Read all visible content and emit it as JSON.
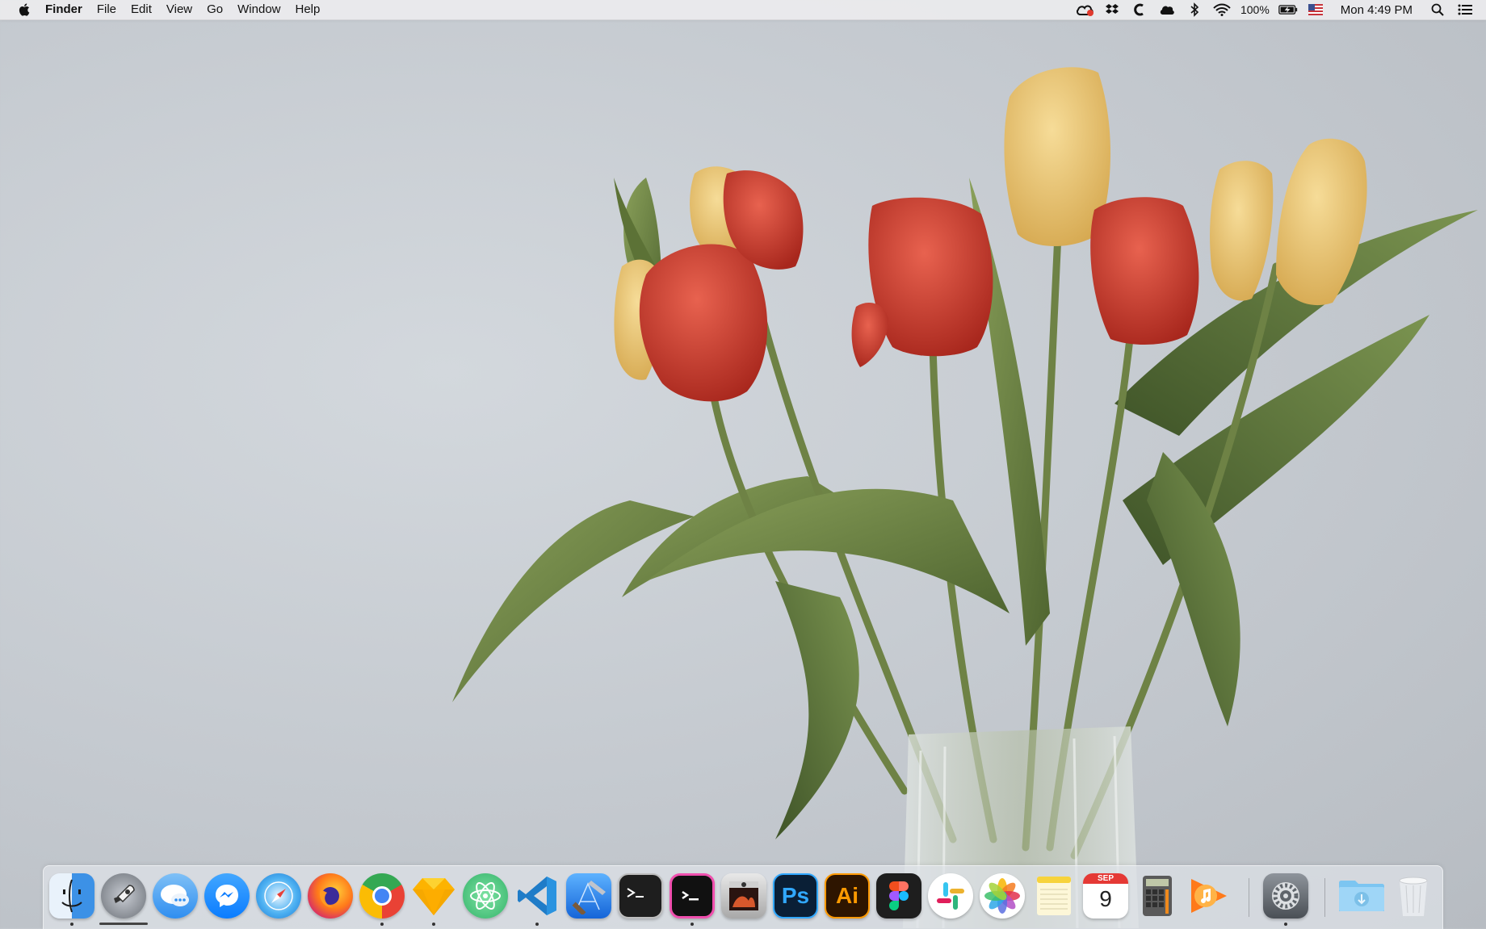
{
  "menubar": {
    "app_name": "Finder",
    "menus": [
      "File",
      "Edit",
      "View",
      "Go",
      "Window",
      "Help"
    ],
    "battery_percent": "100%",
    "clock": "Mon 4:49 PM"
  },
  "dock": {
    "apps": [
      "Finder",
      "Launchpad",
      "Messages",
      "Messenger",
      "Safari",
      "Firefox",
      "Chrome",
      "Sketch",
      "Atom",
      "Visual Studio Code",
      "Xcode",
      "Terminal",
      "Hyper",
      "Photo Booth",
      "Photoshop",
      "Illustrator",
      "Figma",
      "Slack",
      "Photos",
      "Notes",
      "Calendar",
      "Calculator",
      "Music",
      "System Preferences",
      "Downloads",
      "Trash"
    ],
    "photoshop_label": "Ps",
    "illustrator_label": "Ai",
    "calendar_month": "SEP",
    "calendar_day": "9"
  },
  "colors": {
    "menubar": "#ececee",
    "wallpaper": "#c8ccd1",
    "tulip_red": "#cc3a2d",
    "tulip_yellow": "#ecc872",
    "leaf_green": "#657a3e"
  }
}
